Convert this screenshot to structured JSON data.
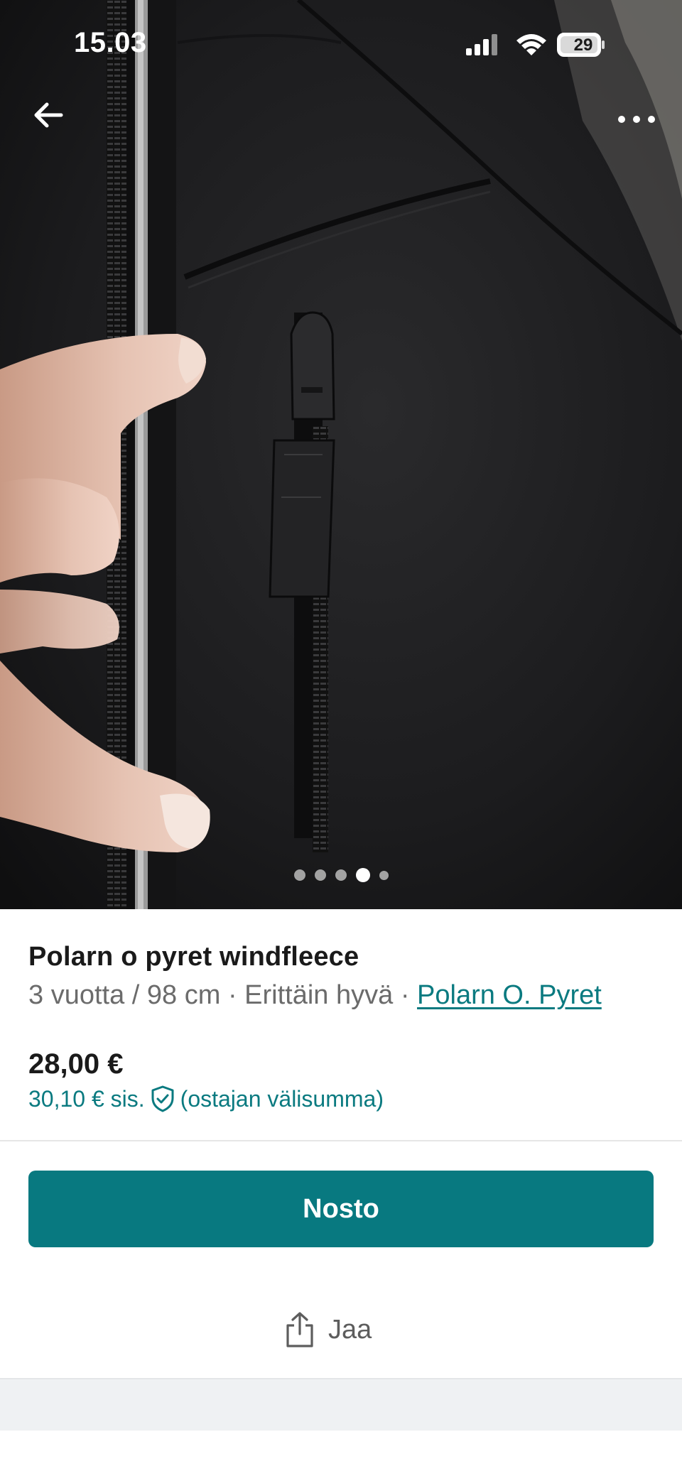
{
  "status_bar": {
    "time": "15.03",
    "battery": "29"
  },
  "nav": {
    "back_icon": "arrow-left-icon",
    "more_icon": "more-horizontal-icon"
  },
  "gallery": {
    "total_images": 5,
    "active_index": 3
  },
  "item": {
    "title": "Polarn o pyret windfleece",
    "size": "3 vuotta / 98 cm",
    "separator": "·",
    "condition": "Erittäin hyvä",
    "brand": "Polarn O. Pyret",
    "price": "28,00 €",
    "buyer_price": "30,10 € sis.",
    "buyer_price_note": "(ostajan välisumma)",
    "protection_icon": "shield-check-icon"
  },
  "actions": {
    "buy_label": "Nosto",
    "share_label": "Jaa",
    "share_icon": "share-icon"
  },
  "colors": {
    "accent": "#087980",
    "link": "#0a7a80"
  }
}
